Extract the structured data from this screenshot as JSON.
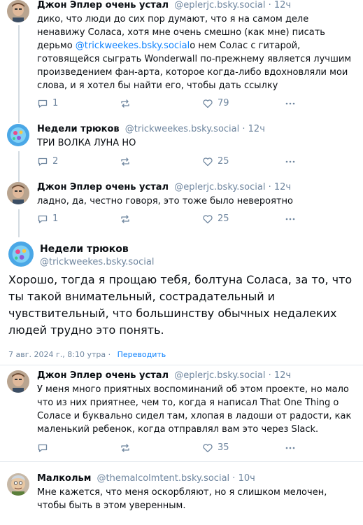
{
  "posts": [
    {
      "author": "Джон Эплер очень устал",
      "handle": "@eplerjc.bsky.social",
      "time": "12ч",
      "text_a": "дико, что люди до сих пор думают, что я на самом деле ненавижу Соласа, хотя мне очень смешно (как мне) писать дерьмо ",
      "link": "@trickweekes.bsky.social",
      "text_b": "о нем Солас с гитарой, готовящейся сыграть Wonderwall по-прежнему является лучшим произведением фан-арта, которое когда-либо вдохновляли мои слова, и я хотел бы найти его, чтобы дать ссылку",
      "replies": "1",
      "reposts": "",
      "likes": "79"
    },
    {
      "author": "Недели трюков",
      "handle": "@trickweekes.bsky.social",
      "time": "12ч",
      "text": "ТРИ ВОЛКА ЛУНА НО",
      "replies": "2",
      "reposts": "",
      "likes": "25"
    },
    {
      "author": "Джон Эплер очень устал",
      "handle": "@eplerjc.bsky.social",
      "time": "12ч",
      "text": "ладно, да, честно говоря, это тоже было невероятно",
      "replies": "1",
      "reposts": "",
      "likes": "25"
    }
  ],
  "main_post": {
    "author": "Недели трюков",
    "handle": "@trickweekes.bsky.social",
    "text": "Хорошо, тогда я прощаю тебя, болтуна Соласа, за то, что ты такой внимательный, сострадательный и чувствительный, что большинству обычных недалеких людей трудно это понять.",
    "date": "7 авг. 2024 г., 8:10 утра",
    "translate": "Переводить"
  },
  "replies": [
    {
      "author": "Джон Эплер очень устал",
      "handle": "@eplerjc.bsky.social",
      "time": "12ч",
      "text": "У меня много приятных воспоминаний об этом проекте, но мало что из них приятнее, чем то, когда я написал That One Thing о Соласе и буквально сидел там, хлопая в ладоши от радости, как маленький ребенок, когда отправлял вам это через Slack.",
      "replies": "",
      "reposts": "",
      "likes": "35"
    },
    {
      "author": "Малкольм",
      "handle": "@themalcolmtent.bsky.social",
      "time": "10ч",
      "text": "Мне кажется, что меня оскорбляют, но я слишком мелочен, чтобы быть в этом уверенным."
    }
  ],
  "separator": "·",
  "icons": {
    "reply": "speech-bubble-icon",
    "repost": "repost-arrows-icon",
    "like": "heart-outline-icon",
    "more": "ellipsis-icon"
  },
  "colors": {
    "link": "#1083fe",
    "muted": "#6f869f",
    "thread_line": "#d4dbe2"
  }
}
